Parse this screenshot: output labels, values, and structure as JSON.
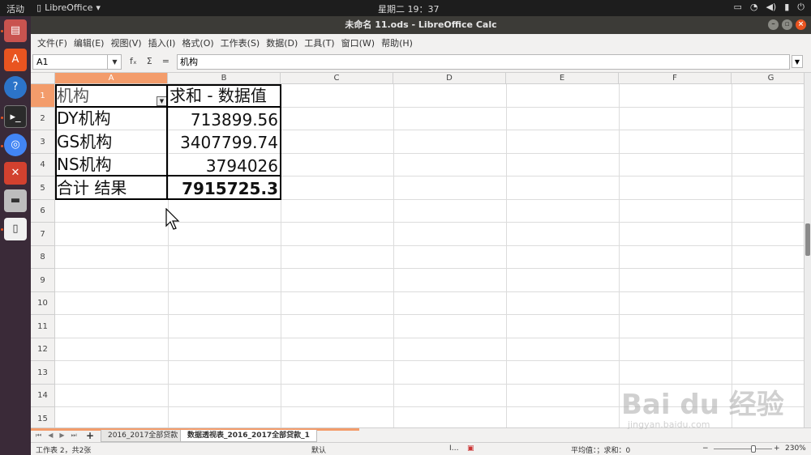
{
  "top_panel": {
    "activities": "活动",
    "app_menu": "LibreOffice",
    "clock": "星期二 19：37"
  },
  "window": {
    "title": "未命名 11.ods - LibreOffice Calc"
  },
  "menu": [
    "文件(F)",
    "编辑(E)",
    "视图(V)",
    "插入(I)",
    "格式(O)",
    "工作表(S)",
    "数据(D)",
    "工具(T)",
    "窗口(W)",
    "帮助(H)"
  ],
  "formula_bar": {
    "name_box": "A1",
    "fx_label": "fₓ",
    "sum_label": "Σ",
    "eq_label": "=",
    "content": "机构"
  },
  "columns": [
    "A",
    "B",
    "C",
    "D",
    "E",
    "F",
    "G"
  ],
  "rows": [
    "1",
    "2",
    "3",
    "4",
    "5",
    "6",
    "7",
    "8",
    "9",
    "10",
    "11",
    "12",
    "13",
    "14",
    "15"
  ],
  "pivot": {
    "header_label": "机构",
    "header_value": "求和 - 数据值",
    "items": [
      {
        "label": "DY机构",
        "value": "713899.56"
      },
      {
        "label": "GS机构",
        "value": "3407799.74"
      },
      {
        "label": "NS机构",
        "value": "3794026"
      }
    ],
    "total_label": "合计 结果",
    "total_value": "7915725.3"
  },
  "sheet_tabs": [
    "2016_2017全部贷款",
    "数据透视表_2016_2017全部贷款_1"
  ],
  "active_tab_index": 1,
  "status": {
    "sheet_info": "工作表 2，共2张",
    "page_style": "默认",
    "summary": "平均值：；求和：0",
    "zoom": "230%",
    "zoom_minus": "−",
    "zoom_plus": "+"
  },
  "watermark": {
    "main": "Bai du 经验",
    "sub": "jingyan.baidu.com"
  }
}
